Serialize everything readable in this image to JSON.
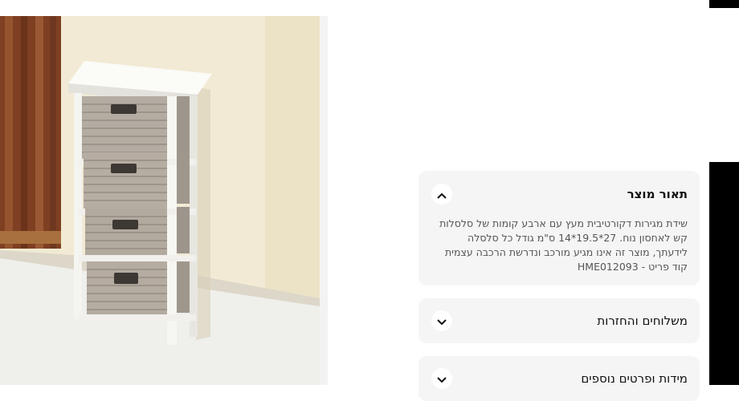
{
  "accordion": {
    "description": {
      "title": "תאור מוצר",
      "body": "שידת מגירות דקורטיבית מעץ עם ארבע קומות של סלסלות קש לאחסון נוח. 27*19.5*14 ס\"מ גודל כל סלסלה לידעתך, מוצר זה אינו מגיע מורכב ונדרשת הרכבה עצמית",
      "sku": "קוד פריט - HME012093",
      "expanded": true,
      "icon": "chevron-up-icon"
    },
    "shipping": {
      "title": "משלוחים והחזרות",
      "expanded": false,
      "icon": "chevron-down-icon"
    },
    "dimensions": {
      "title": "מידות ופרטים נוספים",
      "expanded": false,
      "icon": "chevron-down-icon"
    }
  },
  "colors": {
    "panel_bg": "#f5f5f5",
    "wall": "#f3ecd6",
    "curtain": "#8a4a2a",
    "cabinet": "#f7f7f4",
    "basket": "#b3aa9f"
  }
}
